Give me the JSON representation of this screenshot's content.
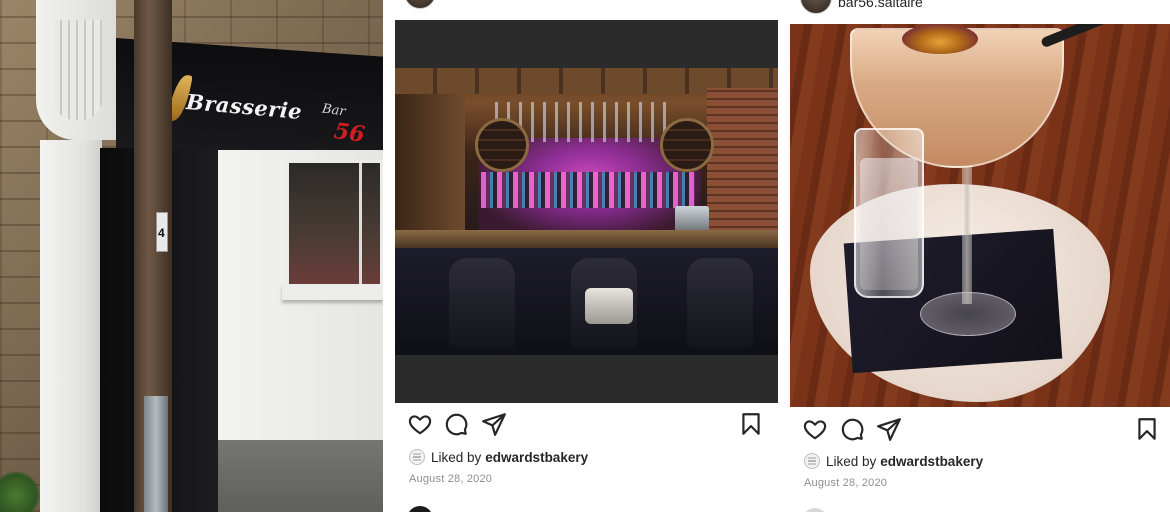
{
  "storefront": {
    "sign_name": "Brasserie",
    "sign_bar": "Bar",
    "sign_number": "56",
    "door_number": "4"
  },
  "posts": [
    {
      "username": "",
      "photo_icon": "bar-interior-photo",
      "liked_prefix": "Liked by",
      "liked_user": "edwardstbakery",
      "date": "August 28, 2020"
    },
    {
      "username": "bar56.saltaire",
      "photo_icon": "cocktail-photo",
      "more_label": "···",
      "liked_prefix": "Liked by",
      "liked_user": "edwardstbakery",
      "date": "August 28, 2020"
    }
  ],
  "icons": {
    "like": "heart-icon",
    "comment": "comment-icon",
    "share": "share-icon",
    "save": "bookmark-icon"
  },
  "colors": {
    "text": "#262626",
    "muted": "#8e8e8e",
    "sign_red": "#d11f1f"
  }
}
